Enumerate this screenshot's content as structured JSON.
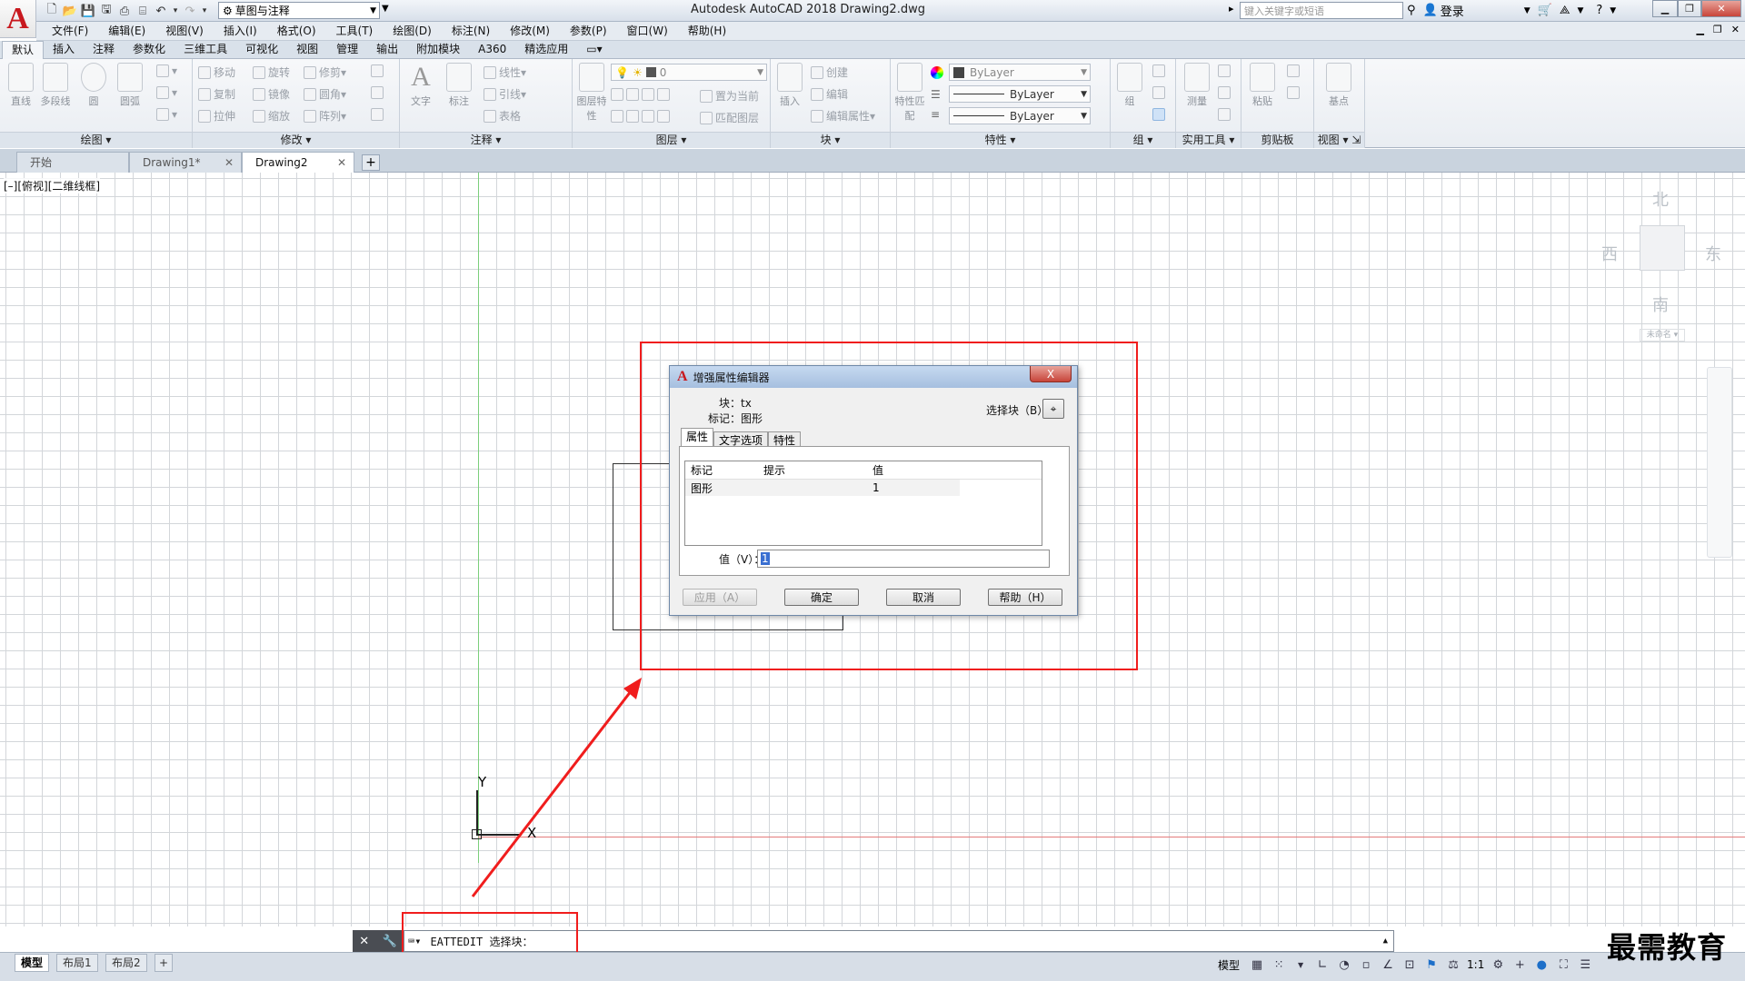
{
  "title_bar": {
    "window_title": "Autodesk AutoCAD 2018    Drawing2.dwg",
    "workspace": "草图与注释",
    "search_placeholder": "键入关键字或短语",
    "login": "登录"
  },
  "menu": [
    "文件(F)",
    "编辑(E)",
    "视图(V)",
    "插入(I)",
    "格式(O)",
    "工具(T)",
    "绘图(D)",
    "标注(N)",
    "修改(M)",
    "参数(P)",
    "窗口(W)",
    "帮助(H)"
  ],
  "ribbon_tabs": [
    "默认",
    "插入",
    "注释",
    "参数化",
    "三维工具",
    "可视化",
    "视图",
    "管理",
    "输出",
    "附加模块",
    "A360",
    "精选应用"
  ],
  "ribbon": {
    "draw": {
      "title": "绘图",
      "line": "直线",
      "polyline": "多段线",
      "circle": "圆",
      "arc": "圆弧"
    },
    "modify": {
      "title": "修改",
      "move": "移动",
      "rotate": "旋转",
      "trim": "修剪",
      "copy": "复制",
      "mirror": "镜像",
      "fillet": "圆角",
      "stretch": "拉伸",
      "scale": "缩放",
      "array": "阵列"
    },
    "annotation": {
      "title": "注释",
      "text": "文字",
      "dimension": "标注",
      "leader": "线性",
      "multileader": "引线",
      "table": "表格"
    },
    "layers": {
      "title": "图层",
      "layer_props": "图层特性",
      "current_layer": "0",
      "set_current": "置为当前",
      "match_layer": "匹配图层"
    },
    "block": {
      "title": "块",
      "insert": "插入",
      "create": "创建",
      "edit": "编辑",
      "edit_attr": "编辑属性"
    },
    "properties": {
      "title": "特性",
      "match": "特性匹配",
      "color": "ByLayer",
      "linetype": "ByLayer",
      "lineweight": "ByLayer"
    },
    "groups": {
      "title": "组",
      "group": "组"
    },
    "utilities": {
      "title": "实用工具",
      "measure": "测量"
    },
    "clipboard": {
      "title": "剪贴板",
      "paste": "粘贴"
    },
    "view": {
      "title": "视图",
      "base": "基点"
    }
  },
  "doc_tabs": [
    {
      "label": "开始"
    },
    {
      "label": "Drawing1*"
    },
    {
      "label": "Drawing2"
    }
  ],
  "viewport": {
    "label": "[–][俯视][二维线框]",
    "compass": {
      "north": "北",
      "south": "南",
      "east": "东",
      "west": "西",
      "unnamed": "未命名"
    },
    "ucs_x": "X",
    "ucs_y": "Y"
  },
  "dialog": {
    "title": "增强属性编辑器",
    "close": "X",
    "block_label": "块：",
    "block_value": "tx",
    "tag_label": "标记：",
    "tag_value": "图形",
    "select_block": "选择块（B）",
    "tabs": [
      "属性",
      "文字选项",
      "特性"
    ],
    "columns": [
      "标记",
      "提示",
      "值"
    ],
    "rows": [
      {
        "tag": "图形",
        "prompt": "",
        "value": "1"
      }
    ],
    "value_label": "值（V）：",
    "value_input": "1",
    "buttons": {
      "apply": "应用（A）",
      "ok": "确定",
      "cancel": "取消",
      "help": "帮助（H）"
    }
  },
  "command_line": {
    "text": "EATTEDIT 选择块："
  },
  "layout_tabs": [
    "模型",
    "布局1",
    "布局2"
  ],
  "status": {
    "model": "模型",
    "scale": "1:1"
  },
  "watermark": "最需教育",
  "colors": {
    "annotation_red": "#f01d1d",
    "autocad_red": "#c8181e",
    "x_axis": "#e47c7c",
    "y_axis": "#7ccf7c"
  }
}
